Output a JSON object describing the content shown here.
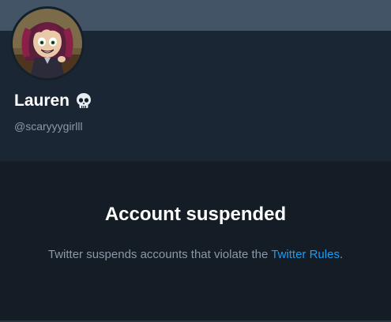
{
  "profile": {
    "display_name": "Lauren",
    "name_emoji_icon": "skull-icon",
    "handle": "@scaryyygirlll",
    "avatar_icon": "cartoon-girl-avatar"
  },
  "suspension": {
    "title": "Account suspended",
    "message_prefix": "Twitter suspends accounts that violate the ",
    "rules_link_text": "Twitter Rules",
    "message_suffix": "."
  },
  "colors": {
    "banner": "#425466",
    "profile_bg": "#1b2634",
    "main_bg": "#141d26",
    "link": "#1d9bf0",
    "muted_text": "#8b98a5"
  }
}
